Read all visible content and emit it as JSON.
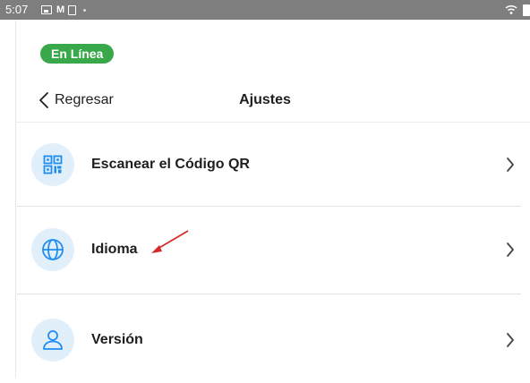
{
  "status_bar": {
    "time": "5:07",
    "left_icons": [
      "image-icon",
      "notification-m-icon",
      "screenshot-icon",
      "dot-icon"
    ],
    "right_icons": [
      "wifi-icon",
      "battery-icon"
    ],
    "m_glyph": "M"
  },
  "connection": {
    "label": "En Línea",
    "color": "#38a84a"
  },
  "header": {
    "back_label": "Regresar",
    "title": "Ajustes"
  },
  "menu": {
    "items": [
      {
        "label": "Escanear el Código QR",
        "icon": "qr-code-icon"
      },
      {
        "label": "Idioma",
        "icon": "globe-icon"
      },
      {
        "label": "Versión",
        "icon": "user-icon"
      }
    ]
  },
  "colors": {
    "accent": "#1f8ef1",
    "icon_bg": "#e1effb",
    "annotation": "#d32b2b"
  }
}
